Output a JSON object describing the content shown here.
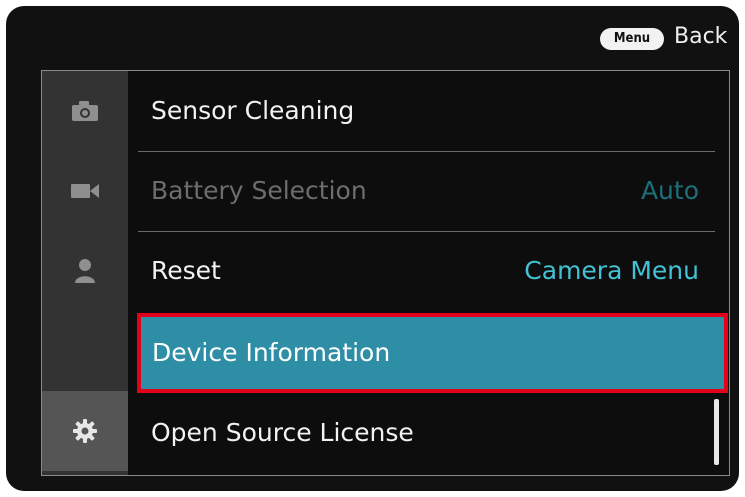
{
  "header": {
    "menu_key": "Menu",
    "back_label": "Back"
  },
  "sidebar": {
    "tabs": [
      {
        "icon": "camera-icon",
        "active": false
      },
      {
        "icon": "video-camera-icon",
        "active": false
      },
      {
        "icon": "person-icon",
        "active": false
      },
      {
        "icon": "gear-icon",
        "active": true
      }
    ]
  },
  "menu": {
    "items": [
      {
        "label": "Sensor Cleaning",
        "value": "",
        "enabled": true
      },
      {
        "label": "Battery Selection",
        "value": "Auto",
        "enabled": false
      },
      {
        "label": "Reset",
        "value": "Camera Menu",
        "enabled": true
      },
      {
        "label": "Device Information",
        "value": "",
        "enabled": true,
        "selected": true
      },
      {
        "label": "Open Source License",
        "value": "",
        "enabled": true
      }
    ]
  },
  "colors": {
    "background": "#111111",
    "accent_value": "#43c2d4",
    "selected_row": "#2e8ea6",
    "highlight_outline": "#e3001b"
  }
}
